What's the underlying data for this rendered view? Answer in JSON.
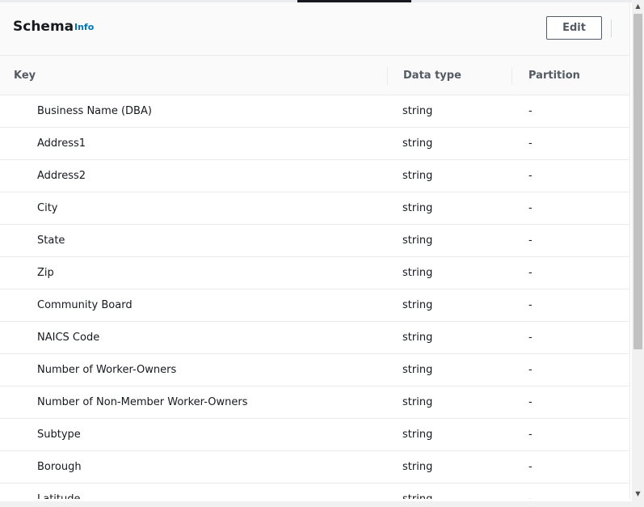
{
  "panel": {
    "title": "Schema",
    "info_label": "Info",
    "edit_label": "Edit"
  },
  "table": {
    "columns": [
      "Key",
      "Data type",
      "Partition"
    ],
    "rows": [
      {
        "key": "Business Name (DBA)",
        "type": "string",
        "partition": "-"
      },
      {
        "key": "Address1",
        "type": "string",
        "partition": "-"
      },
      {
        "key": "Address2",
        "type": "string",
        "partition": "-"
      },
      {
        "key": "City",
        "type": "string",
        "partition": "-"
      },
      {
        "key": "State",
        "type": "string",
        "partition": "-"
      },
      {
        "key": "Zip",
        "type": "string",
        "partition": "-"
      },
      {
        "key": "Community Board",
        "type": "string",
        "partition": "-"
      },
      {
        "key": "NAICS Code",
        "type": "string",
        "partition": "-"
      },
      {
        "key": "Number of Worker-Owners",
        "type": "string",
        "partition": "-"
      },
      {
        "key": "Number of Non-Member Worker-Owners",
        "type": "string",
        "partition": "-"
      },
      {
        "key": "Subtype",
        "type": "string",
        "partition": "-"
      },
      {
        "key": "Borough",
        "type": "string",
        "partition": "-"
      },
      {
        "key": "Latitude",
        "type": "string",
        "partition": "-"
      }
    ]
  },
  "icons": {
    "scroll_up": "scroll-up-arrow-icon",
    "scroll_down": "scroll-down-arrow-icon"
  },
  "colors": {
    "link": "#0073bb",
    "text": "#16191f",
    "header_bg": "#fafafa",
    "border": "#eaeded"
  }
}
